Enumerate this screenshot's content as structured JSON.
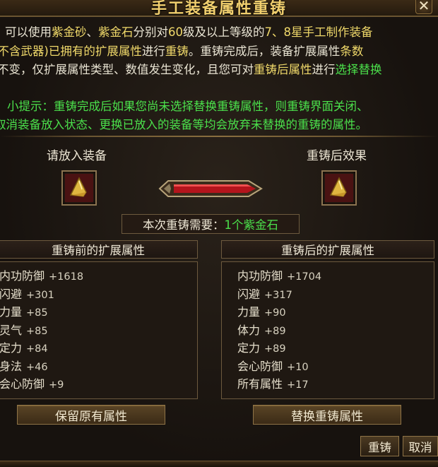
{
  "window": {
    "title": "手工装备属性重铸",
    "close_label": "✕"
  },
  "description": {
    "lines": [
      [
        "可以使用",
        "紫金砂",
        "、",
        "紫金石",
        "分别对",
        "60",
        "级及以上等级的",
        "7、8",
        "星",
        "手工制作装备"
      ],
      [
        "(不含武器)已拥有的",
        "扩展属性",
        "进行",
        "重铸",
        "。重铸完成后，装备扩展属性",
        "条数"
      ],
      [
        "不变，仅扩展属性类型、数值发生变化，且您可对",
        "重铸后属性",
        "进行",
        "选择替换"
      ]
    ]
  },
  "tip": {
    "line1": "小提示：重铸完成后如果您尚未选择替换重铸属性，则重铸界面关闭、",
    "line2": "取消装备放入状态、更换已放入的装备等均会放弃未替换的重铸的属性。"
  },
  "left_slot": {
    "label": "请放入装备"
  },
  "right_slot": {
    "label": "重铸后效果"
  },
  "requirement": {
    "prefix": "本次重铸需要：",
    "value": "1个紫金石"
  },
  "before": {
    "header": "重铸前的扩展属性",
    "attrs": [
      {
        "name": "内功防御",
        "value": "+1618"
      },
      {
        "name": "闪避",
        "value": "+301"
      },
      {
        "name": "力量",
        "value": "+85"
      },
      {
        "name": "灵气",
        "value": "+85"
      },
      {
        "name": "定力",
        "value": "+84"
      },
      {
        "name": "身法",
        "value": "+46"
      },
      {
        "name": "会心防御",
        "value": "+9"
      }
    ]
  },
  "after": {
    "header": "重铸后的扩展属性",
    "attrs": [
      {
        "name": "内功防御",
        "value": "+1704"
      },
      {
        "name": "闪避",
        "value": "+317"
      },
      {
        "name": "力量",
        "value": "+90"
      },
      {
        "name": "体力",
        "value": "+89"
      },
      {
        "name": "定力",
        "value": "+89"
      },
      {
        "name": "会心防御",
        "value": "+10"
      },
      {
        "name": "所有属性",
        "value": "+17"
      }
    ]
  },
  "buttons": {
    "keep": "保留原有属性",
    "replace": "替换重铸属性",
    "reforge": "重铸",
    "cancel": "取消"
  }
}
